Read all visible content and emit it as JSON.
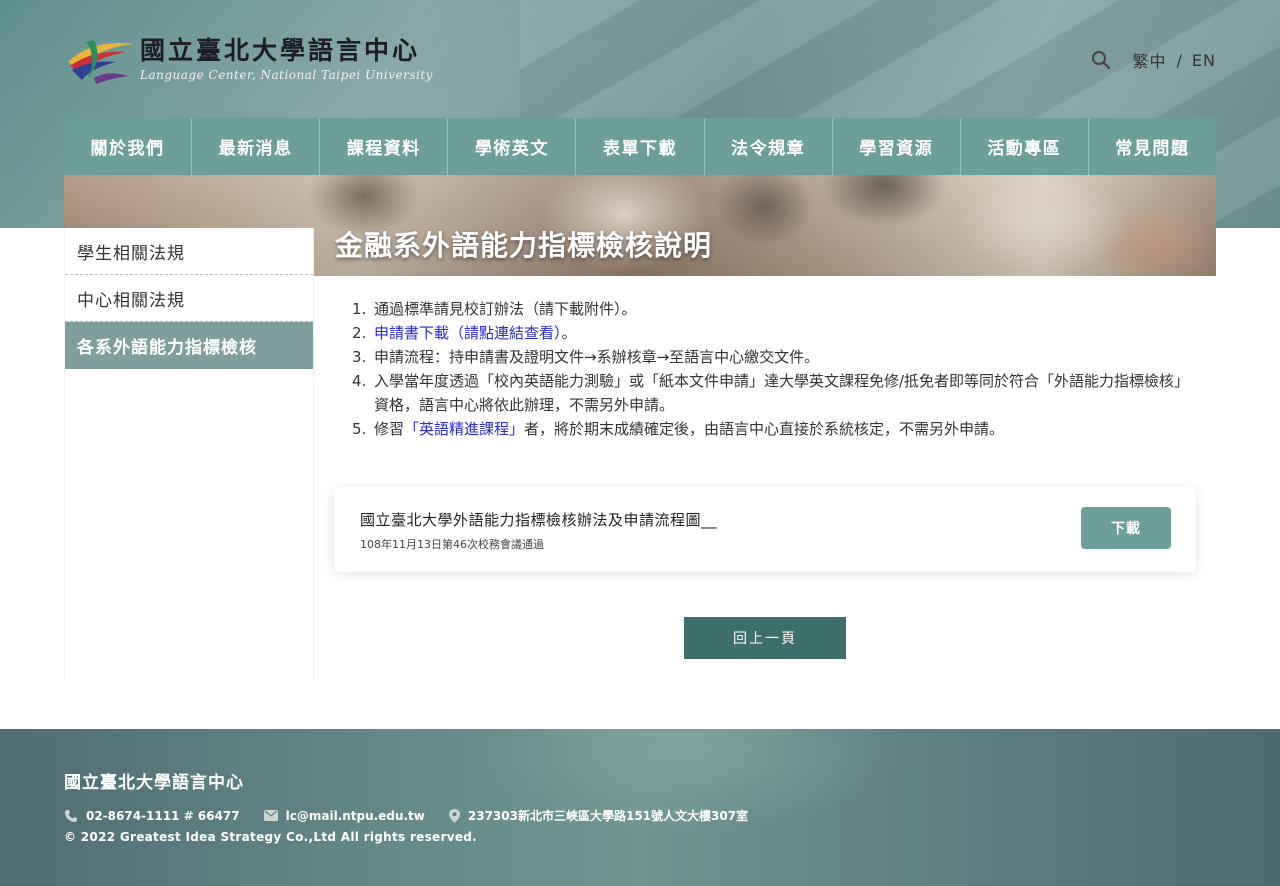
{
  "brand": {
    "name_cn": "國立臺北大學語言中心",
    "name_en": "Language Center, National Taipei University"
  },
  "top_tools": {
    "lang_zh": "繁中",
    "lang_sep": "/",
    "lang_en": "EN"
  },
  "nav": [
    {
      "label": "關於我們"
    },
    {
      "label": "最新消息"
    },
    {
      "label": "課程資料"
    },
    {
      "label": "學術英文"
    },
    {
      "label": "表單下載"
    },
    {
      "label": "法令規章"
    },
    {
      "label": "學習資源"
    },
    {
      "label": "活動專區"
    },
    {
      "label": "常見問題"
    }
  ],
  "page_title": "金融系外語能力指標檢核說明",
  "sidebar": [
    {
      "label": "學生相關法規",
      "active": false
    },
    {
      "label": "中心相關法規",
      "active": false
    },
    {
      "label": "各系外語能力指標檢核",
      "active": true
    }
  ],
  "content": {
    "item1": {
      "num": "1.",
      "text": "通過標準請見校訂辦法（請下載附件）。"
    },
    "item2": {
      "num": "2.",
      "link": "申請書下載（請點連結查看）",
      "after": "。"
    },
    "item3": {
      "num": "3.",
      "text": "申請流程：持申請書及證明文件→系辦核章→至語言中心繳交文件。"
    },
    "item4": {
      "num": "4.",
      "text": "入學當年度透過「校內英語能力測驗」或「紙本文件申請」達大學英文課程免修/抵免者即等同於符合「外語能力指標檢核」資格，語言中心將依此辦理，不需另外申請。"
    },
    "item5": {
      "num": "5.",
      "before": "修習",
      "link": "「英語精進課程」",
      "after": "者，將於期末成績確定後，由語言中心直接於系統核定，不需另外申請。"
    }
  },
  "attachment": {
    "title": "國立臺北大學外語能力指標檢核辦法及申請流程圖__",
    "subtitle": "108年11月13日第46次校務會議通過",
    "download_label": "下載"
  },
  "back_label": "回上一頁",
  "footer": {
    "title": "國立臺北大學語言中心",
    "phone": "02-8674-1111 # 66477",
    "email": "lc@mail.ntpu.edu.tw",
    "address": "237303新北市三峽區大學路151號人文大樓307室",
    "copyright": "© 2022 Greatest Idea Strategy Co.,Ltd All rights reserved."
  },
  "colors": {
    "nav_bg": "#6b9f97",
    "active_side": "#7f9f9c",
    "back_btn": "#3f6f6b",
    "link": "#2a2ad0"
  }
}
